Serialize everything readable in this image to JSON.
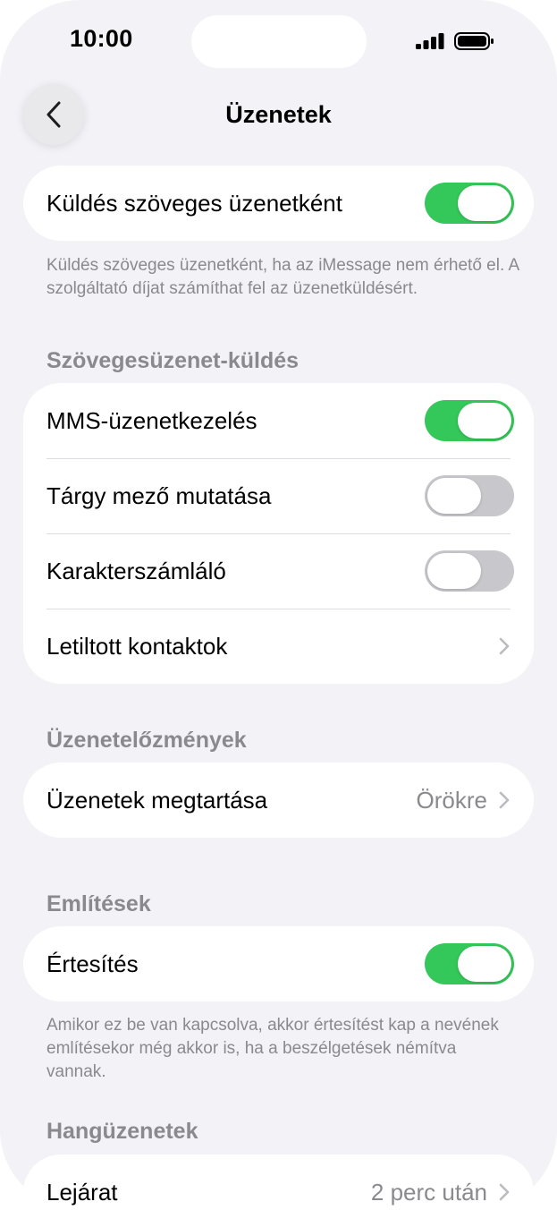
{
  "status_bar": {
    "time": "10:00",
    "signal_icon": "cellular-signal-icon",
    "battery_icon": "battery-icon"
  },
  "nav": {
    "back_icon": "chevron-left-icon",
    "title": "Üzenetek"
  },
  "send_as_sms": {
    "label": "Küldés szöveges üzenetként",
    "enabled": true,
    "footnote": "Küldés szöveges üzenetként, ha az iMessage nem érhető el. A szolgáltató díjat számíthat fel az üzenetküldésért."
  },
  "sms_section": {
    "header": "Szövegesüzenet-küldés",
    "rows": [
      {
        "label": "MMS-üzenetkezelés",
        "type": "toggle",
        "enabled": true
      },
      {
        "label": "Tárgy mező mutatása",
        "type": "toggle",
        "enabled": false
      },
      {
        "label": "Karakterszámláló",
        "type": "toggle",
        "enabled": false
      },
      {
        "label": "Letiltott kontaktok",
        "type": "disclosure"
      }
    ]
  },
  "history_section": {
    "header": "Üzenetelőzmények",
    "keep_label": "Üzenetek megtartása",
    "keep_value": "Örökre"
  },
  "mentions_section": {
    "header": "Említések",
    "notify_label": "Értesítés",
    "notify_enabled": true,
    "footnote": "Amikor ez be van kapcsolva, akkor értesítést kap a nevének említésekor még akkor is, ha a beszélgetések némítva vannak."
  },
  "audio_section": {
    "header": "Hangüzenetek",
    "expire_label": "Lejárat",
    "expire_value": "2 perc után"
  },
  "colors": {
    "toggle_on": "#34c759",
    "toggle_off": "#c7c7cc",
    "secondary_text": "#8a8a8e",
    "background": "#f2f2f7"
  }
}
